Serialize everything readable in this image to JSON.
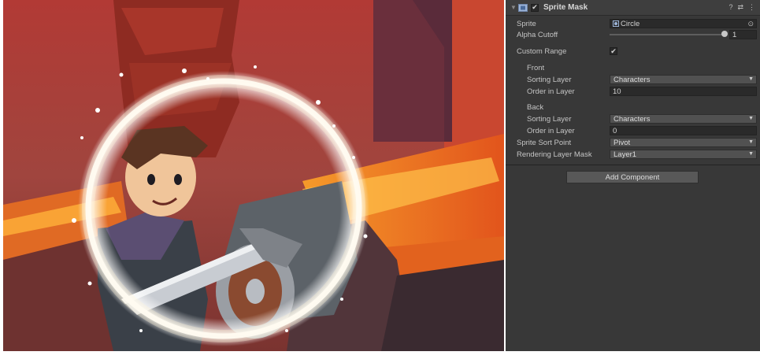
{
  "component": {
    "title": "Sprite Mask",
    "enabled_mark": "✔",
    "tools": [
      "?",
      "⇄",
      "⋮"
    ]
  },
  "fields": {
    "sprite": {
      "label": "Sprite",
      "value": "Circle"
    },
    "alpha_cutoff": {
      "label": "Alpha Cutoff",
      "value": "1",
      "slider_fraction": 1.0
    },
    "custom_range": {
      "label": "Custom Range",
      "checked_mark": "✔"
    },
    "front": {
      "heading": "Front",
      "sorting_layer": {
        "label": "Sorting Layer",
        "value": "Characters"
      },
      "order_in_layer": {
        "label": "Order in Layer",
        "value": "10"
      }
    },
    "back": {
      "heading": "Back",
      "sorting_layer": {
        "label": "Sorting Layer",
        "value": "Characters"
      },
      "order_in_layer": {
        "label": "Order in Layer",
        "value": "0"
      }
    },
    "sprite_sort_point": {
      "label": "Sprite Sort Point",
      "value": "Pivot"
    },
    "rendering_layer_mask": {
      "label": "Rendering Layer Mask",
      "value": "Layer1"
    }
  },
  "add_component_label": "Add Component",
  "icons": {
    "foldout": "triangle-down-icon",
    "component": "sprite-mask-icon",
    "sprite_picker": "object-picker-icon",
    "dropdown": "chevron-down-icon"
  },
  "colors": {
    "inspector_bg": "#383838",
    "scene_lava": "#e0521e",
    "ring_glow": "#ffffff"
  }
}
